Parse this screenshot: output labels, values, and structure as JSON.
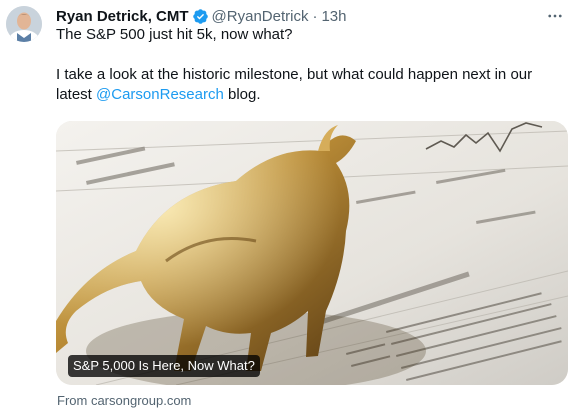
{
  "author": {
    "display_name": "Ryan Detrick, CMT",
    "handle": "@RyanDetrick",
    "separator": "·",
    "time": "13h"
  },
  "tweet": {
    "line1": "The S&P 500 just hit 5k, now what?",
    "line2_before": "I take a look at the historic milestone, but what could happen next in our latest ",
    "mention": "@CarsonResearch",
    "line2_after": " blog."
  },
  "card": {
    "title": "S&P 5,000 Is Here, Now What?",
    "source": "From carsongroup.com"
  },
  "colors": {
    "accent": "#1d9bf0",
    "secondary_text": "#536471"
  },
  "icons": {
    "verified": "verified-badge-icon",
    "more": "more-horizontal-icon"
  }
}
